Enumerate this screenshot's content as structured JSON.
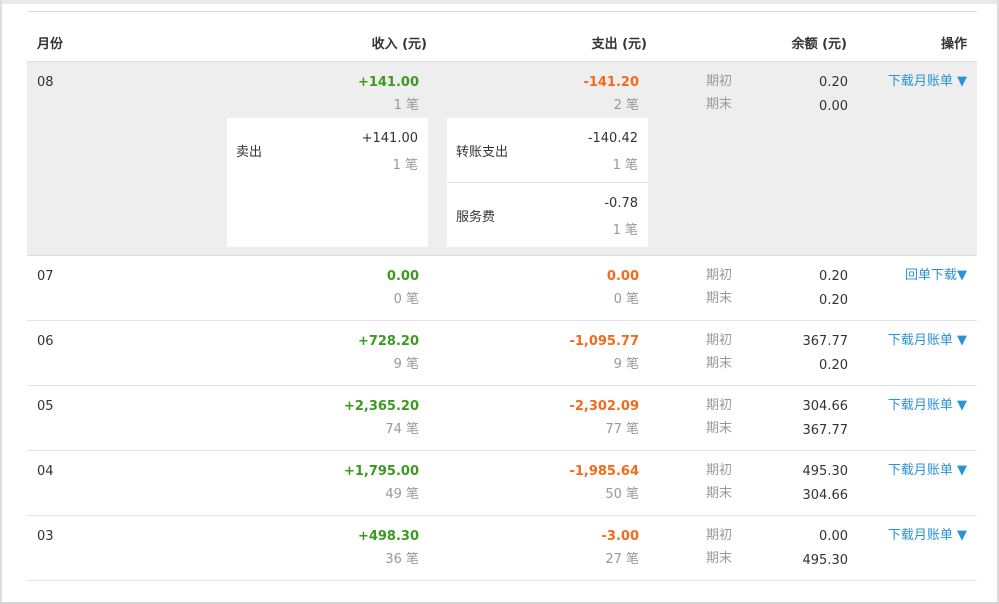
{
  "header": {
    "month": "月份",
    "income": "收入 (元)",
    "expense": "支出 (元)",
    "balance": "余额 (元)",
    "action": "操作"
  },
  "labels": {
    "begin": "期初",
    "end": "期末"
  },
  "expanded": {
    "month": "08",
    "income_amount": "+141.00",
    "income_count": "1 笔",
    "expense_amount": "-141.20",
    "expense_count": "2 笔",
    "balance_begin": "0.20",
    "balance_end": "0.00",
    "action": "下载月账单 ▼",
    "income_details": [
      {
        "label": "卖出",
        "amount": "+141.00",
        "count": "1 笔"
      }
    ],
    "expense_details": [
      {
        "label": "转账支出",
        "amount": "-140.42",
        "count": "1 笔"
      },
      {
        "label": "服务费",
        "amount": "-0.78",
        "count": "1 笔"
      }
    ]
  },
  "rows": [
    {
      "month": "07",
      "income_amount": "0.00",
      "income_count": "0 笔",
      "expense_amount": "0.00",
      "expense_count": "0 笔",
      "balance_begin": "0.20",
      "balance_end": "0.20",
      "action": "回单下载▼"
    },
    {
      "month": "06",
      "income_amount": "+728.20",
      "income_count": "9 笔",
      "expense_amount": "-1,095.77",
      "expense_count": "9 笔",
      "balance_begin": "367.77",
      "balance_end": "0.20",
      "action": "下载月账单 ▼"
    },
    {
      "month": "05",
      "income_amount": "+2,365.20",
      "income_count": "74 笔",
      "expense_amount": "-2,302.09",
      "expense_count": "77 笔",
      "balance_begin": "304.66",
      "balance_end": "367.77",
      "action": "下载月账单 ▼"
    },
    {
      "month": "04",
      "income_amount": "+1,795.00",
      "income_count": "49 笔",
      "expense_amount": "-1,985.64",
      "expense_count": "50 笔",
      "balance_begin": "495.30",
      "balance_end": "304.66",
      "action": "下载月账单 ▼"
    },
    {
      "month": "03",
      "income_amount": "+498.30",
      "income_count": "36 笔",
      "expense_amount": "-3.00",
      "expense_count": "27 笔",
      "balance_begin": "0.00",
      "balance_end": "495.30",
      "action": "下载月账单 ▼"
    }
  ],
  "colors": {
    "income": "#3b9a1f",
    "expense": "#f36a1c",
    "link": "#2a93d5",
    "muted": "#999999",
    "expanded_bg": "#eeeeee"
  }
}
